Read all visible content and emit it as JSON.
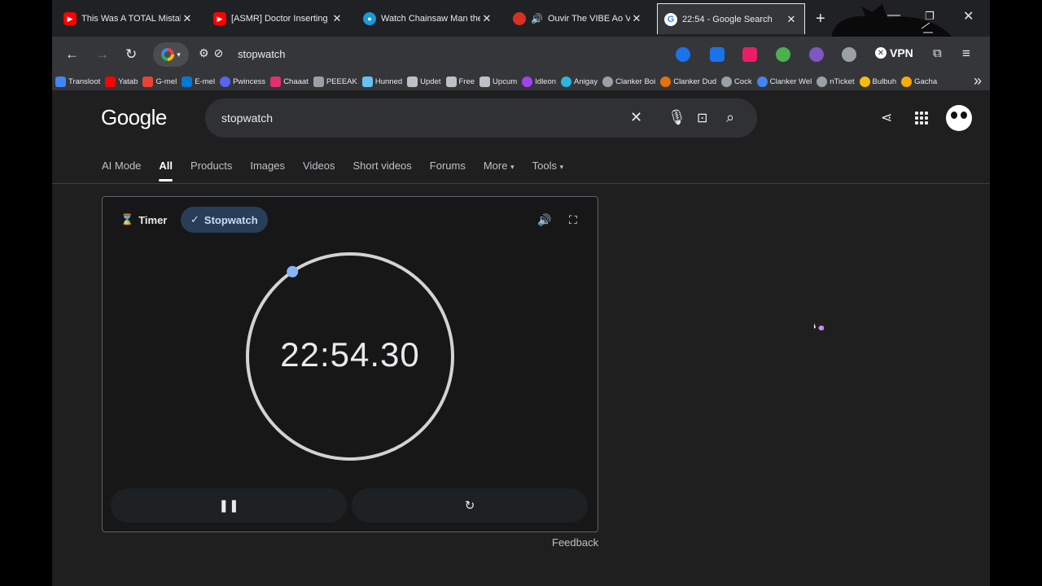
{
  "tabs": [
    {
      "title": "This Was A TOTAL Mistake...",
      "icon": "youtube-icon",
      "color": "#ff0000"
    },
    {
      "title": "[ASMR] Doctor Inserting & I",
      "icon": "youtube-icon",
      "color": "#ff0000"
    },
    {
      "title": "Watch Chainsaw Man the M",
      "icon": "globe-icon",
      "color": "#1a9bd8"
    },
    {
      "title": "Ouvir The VIBE Ao Vivo",
      "icon": "speaker-icon",
      "color": "#d93025"
    },
    {
      "title": "22:54 - Google Search",
      "icon": "google-icon",
      "color": "#ffffff"
    }
  ],
  "toolbar": {
    "url": "stopwatch",
    "vpn_label": "VPN"
  },
  "bookmarks": [
    {
      "label": "Transloot",
      "color": "#4285f4"
    },
    {
      "label": "Yatab",
      "color": "#ff0000"
    },
    {
      "label": "G-mel",
      "color": "#ea4335"
    },
    {
      "label": "E-mel",
      "color": "#0078d4"
    },
    {
      "label": "Pwincess",
      "color": "#5865f2"
    },
    {
      "label": "Chaaat",
      "color": "#e1306c"
    },
    {
      "label": "PEEEAK",
      "color": "#9aa0a6"
    },
    {
      "label": "Hunned",
      "color": "#1b2838"
    },
    {
      "label": "Updet",
      "color": "#9aa0a6"
    },
    {
      "label": "Free",
      "color": "#9aa0a6"
    },
    {
      "label": "Upcum",
      "color": "#9aa0a6"
    },
    {
      "label": "Idleon",
      "color": "#a142f4"
    },
    {
      "label": "Anigay",
      "color": "#2bb5e0"
    },
    {
      "label": "Clanker Boi",
      "color": "#9aa0a6"
    },
    {
      "label": "Clanker Dud",
      "color": "#e8710a"
    },
    {
      "label": "Cock",
      "color": "#9aa0a6"
    },
    {
      "label": "Clanker Wel",
      "color": "#4285f4"
    },
    {
      "label": "nTicket",
      "color": "#9aa0a6"
    },
    {
      "label": "Bulbuh",
      "color": "#fbbc05"
    },
    {
      "label": "Gacha",
      "color": "#f9ab00"
    }
  ],
  "search": {
    "logo": "Google",
    "query": "stopwatch"
  },
  "filters": [
    "AI Mode",
    "All",
    "Products",
    "Images",
    "Videos",
    "Short videos",
    "Forums",
    "More",
    "Tools"
  ],
  "stopwatch": {
    "timer_label": "Timer",
    "stopwatch_label": "Stopwatch",
    "time": "22:54.30",
    "progress_seconds": 54.3
  },
  "feedback": "Feedback",
  "colors": {
    "accent": "#8ab4f8",
    "dial": "#d5d2cf",
    "chip_selected": "#283d58"
  }
}
